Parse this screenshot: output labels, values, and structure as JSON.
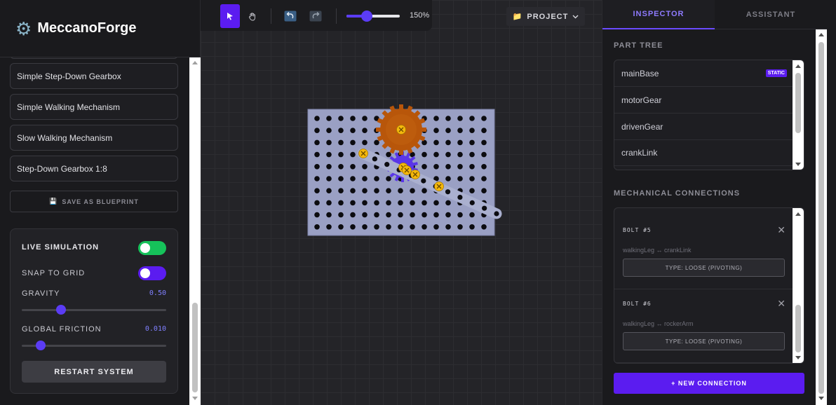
{
  "app": {
    "title": "MeccanoForge",
    "logo_icon": "gear-icon"
  },
  "blueprints": {
    "items": [
      "Simple Step-Down Gearbox",
      "Simple Walking Mechanism",
      "Slow Walking Mechanism",
      "Step-Down Gearbox 1:8"
    ],
    "save_label": "SAVE AS BLUEPRINT",
    "save_icon": "floppy-disk-icon"
  },
  "simulation": {
    "live_label": "LIVE SIMULATION",
    "live_on": true,
    "snap_label": "SNAP TO GRID",
    "snap_on": true,
    "gravity_label": "GRAVITY",
    "gravity_value": "0.50",
    "gravity_fraction": 0.27,
    "friction_label": "GLOBAL FRICTION",
    "friction_value": "0.010",
    "friction_fraction": 0.13,
    "restart_label": "RESTART SYSTEM"
  },
  "toolbar": {
    "tools": [
      "select-cursor-icon",
      "hand-pan-icon",
      "undo-icon",
      "redo-icon"
    ],
    "zoom_value": "150%",
    "zoom_fraction": 0.38,
    "project_label": "PROJECT",
    "project_icon": "folder-icon"
  },
  "tabs": {
    "inspector": "INSPECTOR",
    "assistant": "ASSISTANT",
    "active": "INSPECTOR"
  },
  "part_tree": {
    "title": "PART TREE",
    "items": [
      {
        "name": "mainBase",
        "badge": "STATIC"
      },
      {
        "name": "motorGear",
        "badge": ""
      },
      {
        "name": "drivenGear",
        "badge": ""
      },
      {
        "name": "crankLink",
        "badge": ""
      }
    ]
  },
  "connections": {
    "title": "MECHANICAL CONNECTIONS",
    "items": [
      {
        "title": "BOLT #5",
        "desc": "walkingLeg ↔ crankLink",
        "type": "TYPE: LOOSE (PIVOTING)"
      },
      {
        "title": "BOLT #6",
        "desc": "walkingLeg ↔ rockerArm",
        "type": "TYPE: LOOSE (PIVOTING)"
      }
    ],
    "new_label": "+ NEW CONNECTION"
  },
  "colors": {
    "accent": "#5b1cf0",
    "toggle_live": "#16c25a",
    "toggle_snap": "#5b1cf0",
    "plate": "#9aa0c4",
    "gear_orange": "#b8560a",
    "gear_purple": "#5a36e8",
    "bolt": "#f5b80c"
  }
}
